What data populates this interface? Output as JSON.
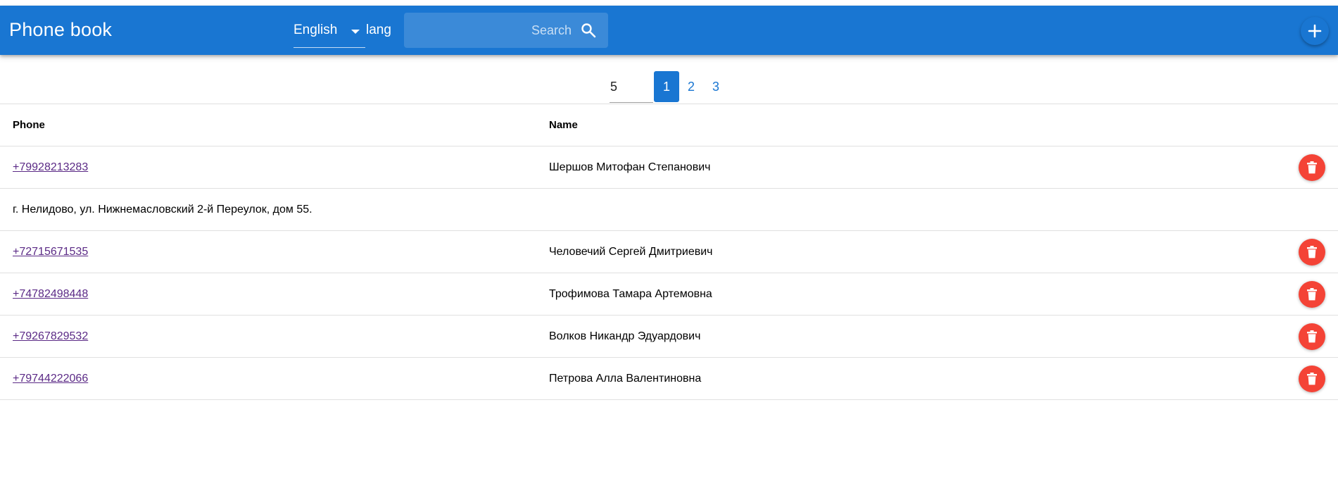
{
  "app": {
    "title": "Phone book"
  },
  "language": {
    "selected": "English",
    "label": "lang"
  },
  "search": {
    "placeholder": "Search"
  },
  "pagination": {
    "page_size": "5",
    "pages": [
      "1",
      "2",
      "3"
    ],
    "current_page": "1"
  },
  "table": {
    "headers": {
      "phone": "Phone",
      "name": "Name"
    },
    "rows": [
      {
        "phone": "+79928213283",
        "name": "Шершов Митофан Степанович"
      },
      {
        "phone": "+72715671535",
        "name": "Человечий Сергей Дмитриевич"
      },
      {
        "phone": "+74782498448",
        "name": "Трофимова Тамара Артемовна"
      },
      {
        "phone": "+79267829532",
        "name": "Волков Никандр Эдуардович"
      },
      {
        "phone": "+79744222066",
        "name": "Петрова Алла Валентиновна"
      }
    ],
    "expanded_address": "г. Нелидово, ул. Нижнемасловский 2-й Переулок, дом 55."
  },
  "colors": {
    "appbar": "#1976d2",
    "accent": "#1976d2",
    "delete": "#f44336",
    "link": "#5b2a86"
  },
  "icons": {
    "search": "search-icon",
    "add": "plus-icon",
    "delete": "trash-icon",
    "dropdown": "caret-down-icon"
  }
}
